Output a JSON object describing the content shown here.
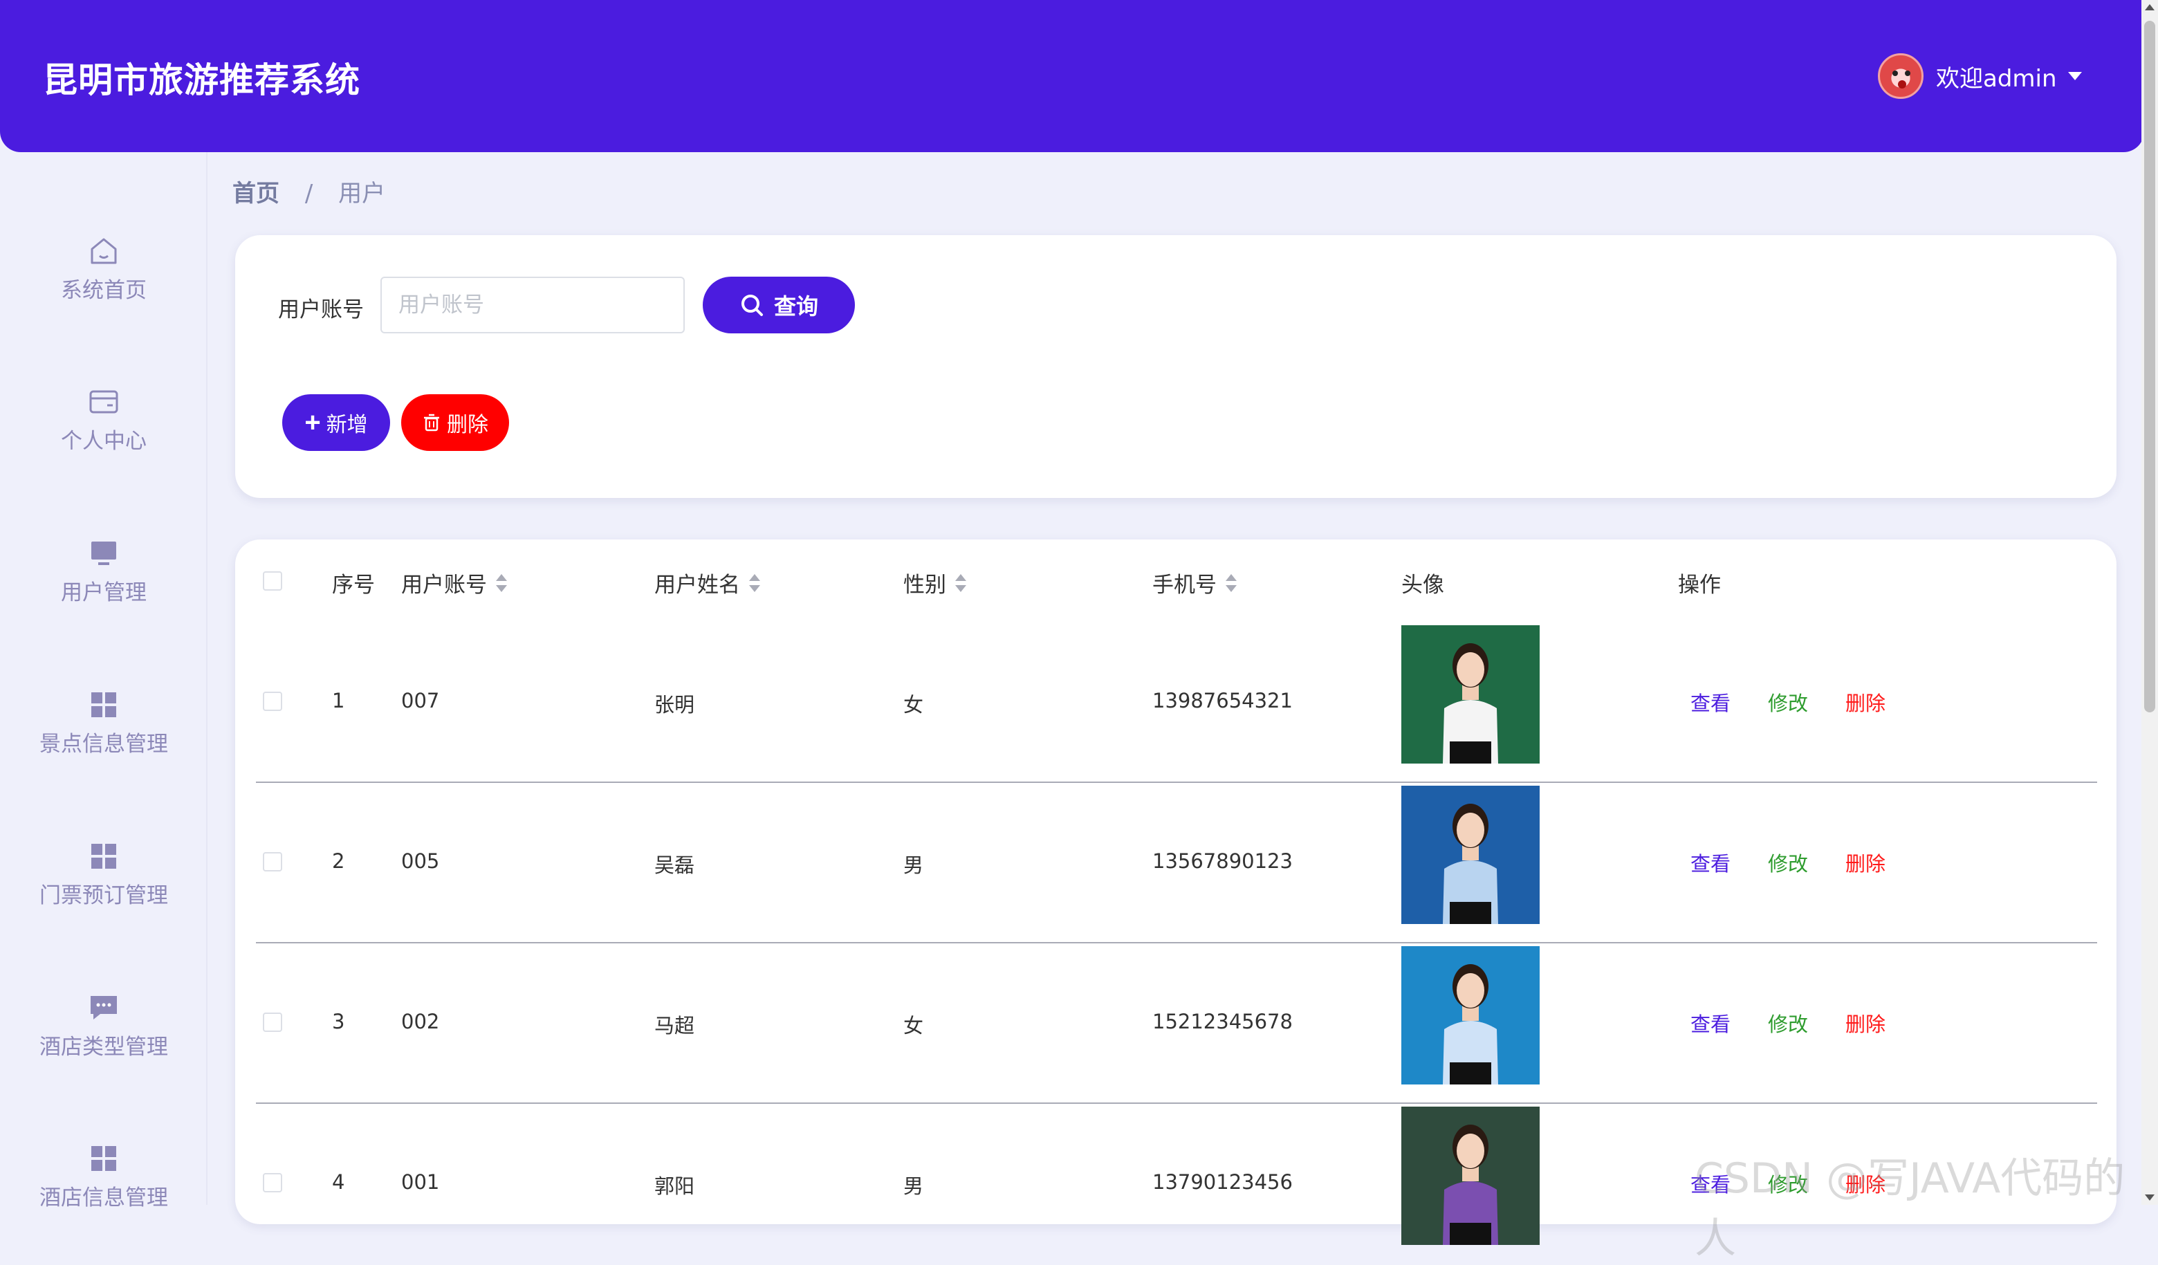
{
  "header": {
    "title": "昆明市旅游推荐系统",
    "welcome": "欢迎admin"
  },
  "sidebar": {
    "items": [
      {
        "label": "系统首页",
        "icon": "home-icon"
      },
      {
        "label": "个人中心",
        "icon": "id-card-icon"
      },
      {
        "label": "用户管理",
        "icon": "monitor-icon"
      },
      {
        "label": "景点信息管理",
        "icon": "grid-icon"
      },
      {
        "label": "门票预订管理",
        "icon": "grid-icon"
      },
      {
        "label": "酒店类型管理",
        "icon": "chat-icon"
      },
      {
        "label": "酒店信息管理",
        "icon": "grid-icon"
      }
    ]
  },
  "breadcrumb": {
    "home": "首页",
    "separator": "/",
    "current": "用户"
  },
  "search": {
    "label": "用户账号",
    "placeholder": "用户账号",
    "query_button": "查询",
    "add_button": "新增",
    "delete_button": "删除"
  },
  "table": {
    "headers": {
      "index": "序号",
      "account": "用户账号",
      "name": "用户姓名",
      "gender": "性别",
      "phone": "手机号",
      "avatar": "头像",
      "actions": "操作"
    },
    "rows": [
      {
        "index": "1",
        "account": "007",
        "name": "张明",
        "gender": "女",
        "phone": "13987654321",
        "photo_bg": "#1f6b45",
        "shirt": "#f4f4f4"
      },
      {
        "index": "2",
        "account": "005",
        "name": "吴磊",
        "gender": "男",
        "phone": "13567890123",
        "photo_bg": "#1e5fa8",
        "shirt": "#b9d4f0"
      },
      {
        "index": "3",
        "account": "002",
        "name": "马超",
        "gender": "女",
        "phone": "15212345678",
        "photo_bg": "#1e88c8",
        "shirt": "#cfe2f7"
      },
      {
        "index": "4",
        "account": "001",
        "name": "郭阳",
        "gender": "男",
        "phone": "13790123456",
        "photo_bg": "#2f4b3d",
        "shirt": "#7b4fb0"
      }
    ],
    "actions": {
      "view": "查看",
      "edit": "修改",
      "delete": "删除"
    }
  },
  "watermark": "CSDN @写JAVA代码的人",
  "colors": {
    "primary": "#4b1cdf",
    "danger": "#ff0000",
    "success": "#2e9c2e",
    "page_bg": "#eff0fb"
  }
}
